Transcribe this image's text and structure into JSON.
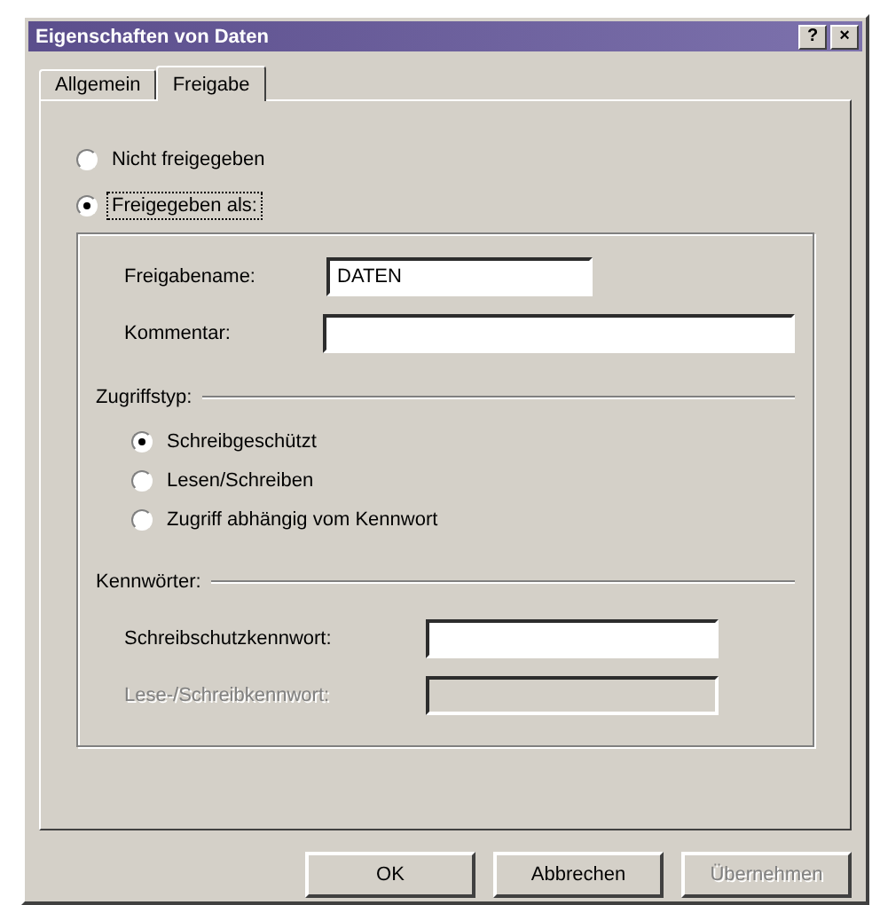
{
  "window": {
    "title": "Eigenschaften von Daten",
    "controls": [
      "?",
      "×"
    ]
  },
  "tabs": [
    {
      "label": "Allgemein",
      "selected": false
    },
    {
      "label": "Freigabe",
      "selected": true
    }
  ],
  "share_options": [
    {
      "label": "Nicht freigegeben",
      "selected": false
    },
    {
      "label": "Freigegeben als:",
      "selected": true
    }
  ],
  "share_name": {
    "label": "Freigabename:",
    "value": "DATEN"
  },
  "comment": {
    "label": "Kommentar:"
  },
  "access_type": {
    "label": "Zugriffstyp:",
    "options": [
      {
        "label": "Schreibgeschützt",
        "selected": true
      },
      {
        "label": "Lesen/Schreiben",
        "selected": false
      },
      {
        "label": "Zugriff abhängig vom Kennwort",
        "selected": false
      }
    ]
  },
  "passwords": {
    "label": "Kennwörter:",
    "fields": [
      {
        "label": "Schreibschutzkennwort:",
        "disabled": false
      },
      {
        "label": "Lese-/Schreibkennwort:",
        "disabled": true
      }
    ]
  },
  "buttons": [
    {
      "label": "OK",
      "disabled": false
    },
    {
      "label": "Abbrechen",
      "disabled": false
    },
    {
      "label": "Übernehmen",
      "disabled": true
    }
  ]
}
